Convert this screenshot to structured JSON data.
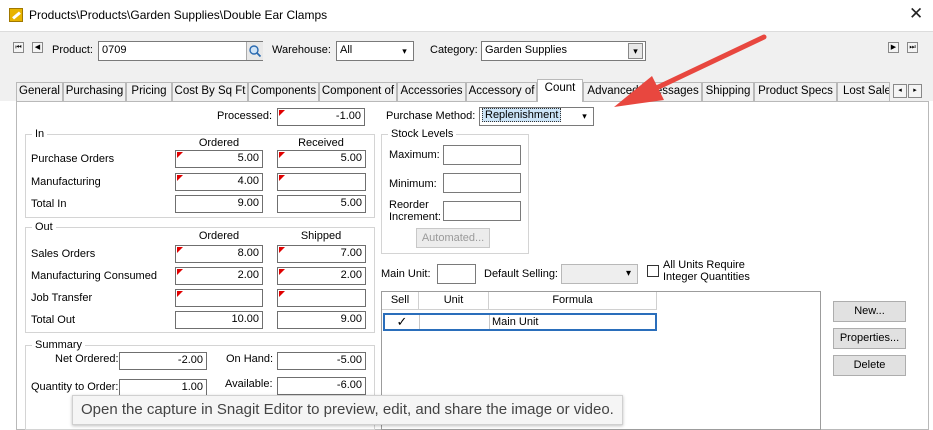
{
  "window": {
    "title": "Products\\Products\\Garden Supplies\\Double Ear Clamps",
    "close_glyph": "✕"
  },
  "toolbar": {
    "product_label": "Product:",
    "product_value": "0709",
    "warehouse_label": "Warehouse:",
    "warehouse_value": "All",
    "category_label": "Category:",
    "category_value": "Garden Supplies"
  },
  "tabs": [
    {
      "label": "General"
    },
    {
      "label": "Purchasing"
    },
    {
      "label": "Pricing"
    },
    {
      "label": "Cost By Sq Ft"
    },
    {
      "label": "Components"
    },
    {
      "label": "Component of"
    },
    {
      "label": "Accessories"
    },
    {
      "label": "Accessory of"
    },
    {
      "label": "Count",
      "active": true
    },
    {
      "label": "Advanced"
    },
    {
      "label": "Messages"
    },
    {
      "label": "Shipping"
    },
    {
      "label": "Product Specs"
    },
    {
      "label": "Lost Sale"
    }
  ],
  "count": {
    "processed_label": "Processed:",
    "processed_value": "-1.00",
    "purchase_method_label": "Purchase Method:",
    "purchase_method_value": "Replenishment",
    "in": {
      "title": "In",
      "col_ordered": "Ordered",
      "col_received": "Received",
      "rows": [
        {
          "label": "Purchase Orders",
          "ordered": "5.00",
          "received": "5.00"
        },
        {
          "label": "Manufacturing",
          "ordered": "4.00",
          "received": ""
        },
        {
          "label": "Total In",
          "ordered": "9.00",
          "received": "5.00"
        }
      ]
    },
    "out": {
      "title": "Out",
      "col_ordered": "Ordered",
      "col_shipped": "Shipped",
      "rows": [
        {
          "label": "Sales Orders",
          "ordered": "8.00",
          "shipped": "7.00"
        },
        {
          "label": "Manufacturing Consumed",
          "ordered": "2.00",
          "shipped": "2.00"
        },
        {
          "label": "Job Transfer",
          "ordered": "",
          "shipped": ""
        },
        {
          "label": "Total Out",
          "ordered": "10.00",
          "shipped": "9.00"
        }
      ]
    },
    "summary": {
      "title": "Summary",
      "net_ordered_label": "Net Ordered:",
      "net_ordered_value": "-2.00",
      "on_hand_label": "On Hand:",
      "on_hand_value": "-5.00",
      "qty_to_order_label": "Quantity to Order:",
      "qty_to_order_value": "1.00",
      "available_label": "Available:",
      "available_value": "-6.00"
    },
    "stock_levels": {
      "title": "Stock Levels",
      "maximum_label": "Maximum:",
      "minimum_label": "Minimum:",
      "reorder_label_1": "Reorder",
      "reorder_label_2": "Increment:",
      "automated_button": "Automated..."
    },
    "units": {
      "main_unit_label": "Main Unit:",
      "default_selling_label": "Default Selling:",
      "all_units_label_1": "All Units Require",
      "all_units_label_2": "Integer Quantities",
      "columns": [
        "Sell",
        "Unit",
        "Formula"
      ],
      "rows": [
        {
          "sell": "✓",
          "unit": "",
          "formula": "Main Unit"
        }
      ],
      "new_button": "New...",
      "properties_button": "Properties...",
      "delete_button": "Delete"
    }
  },
  "tooltip": {
    "text": "Open the capture in Snagit Editor to preview, edit, and share the image or video."
  },
  "annotation": {
    "arrow_color": "#e8473f"
  }
}
